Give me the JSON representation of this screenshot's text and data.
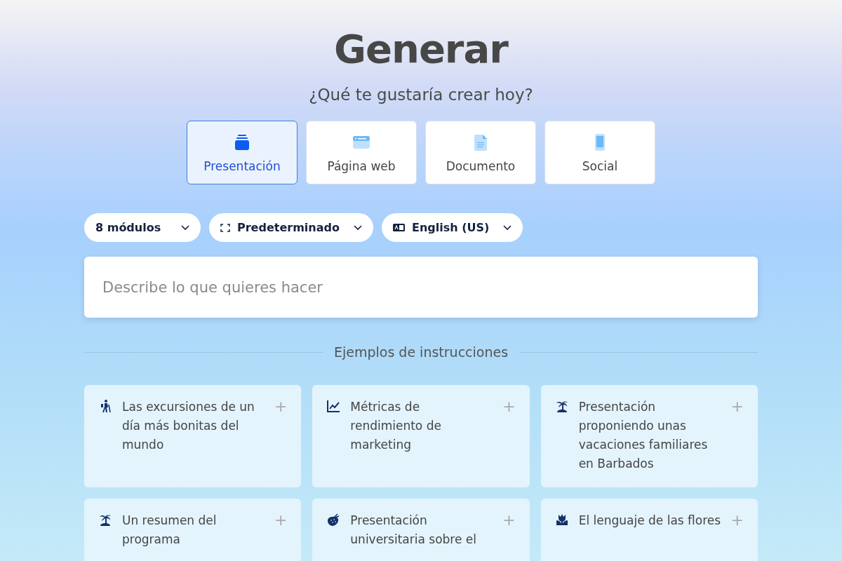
{
  "title": "Generar",
  "subtitle": "¿Qué te gustaría crear hoy?",
  "tabs": [
    {
      "label": "Presentación",
      "selected": true
    },
    {
      "label": "Página web",
      "selected": false
    },
    {
      "label": "Documento",
      "selected": false
    },
    {
      "label": "Social",
      "selected": false
    }
  ],
  "dropdowns": [
    {
      "label": "8 módulos"
    },
    {
      "label": "Predeterminado"
    },
    {
      "label": "English (US)"
    }
  ],
  "prompt": {
    "placeholder": "Describe lo que quieres hacer"
  },
  "examples_heading": "Ejemplos de instrucciones",
  "examples": [
    {
      "text": "Las excursiones de un día más bonitas del mundo"
    },
    {
      "text": "Métricas de rendimiento de marketing"
    },
    {
      "text": "Presentación proponiendo unas vacaciones familiares en Barbados"
    },
    {
      "text": "Un resumen del programa"
    },
    {
      "text": "Presentación universitaria sobre el"
    },
    {
      "text": "El lenguaje de las flores"
    }
  ],
  "add_symbol": "+"
}
